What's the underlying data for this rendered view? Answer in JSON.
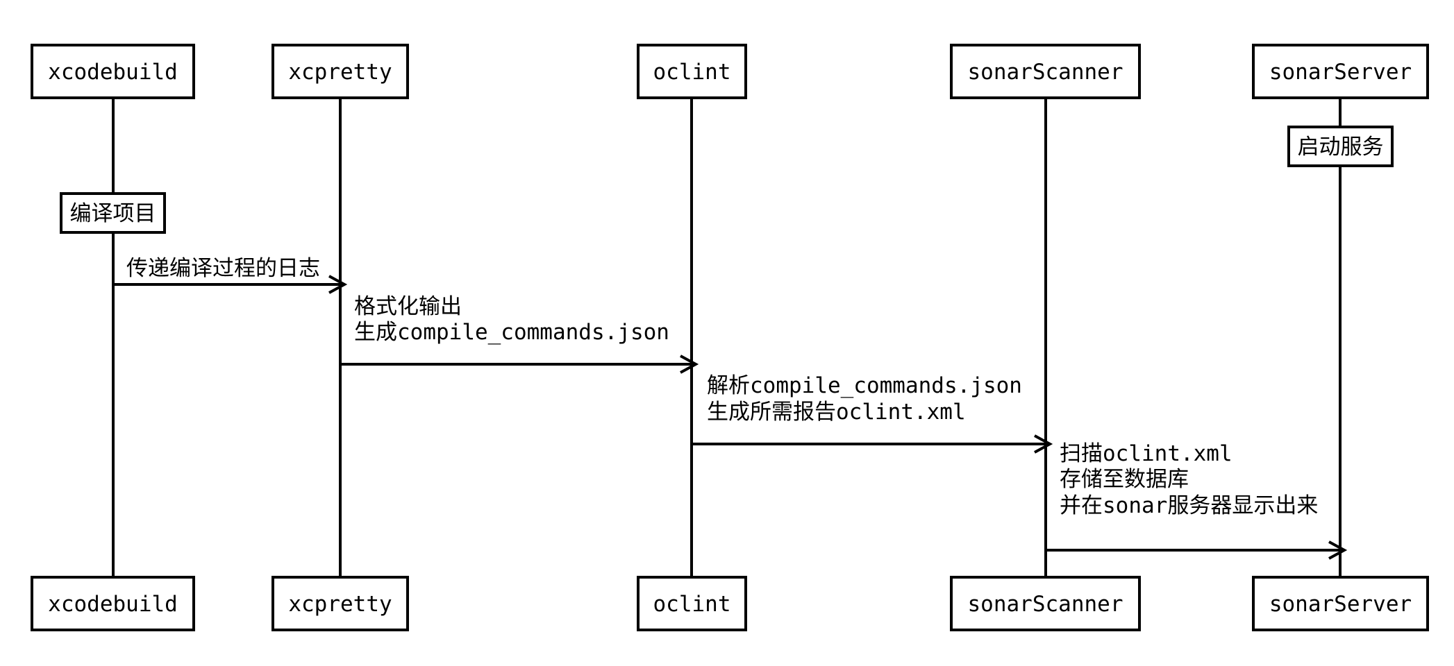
{
  "participants": [
    {
      "id": "xcodebuild",
      "label": "xcodebuild"
    },
    {
      "id": "xcpretty",
      "label": "xcpretty"
    },
    {
      "id": "oclint",
      "label": "oclint"
    },
    {
      "id": "sonarScanner",
      "label": "sonarScanner"
    },
    {
      "id": "sonarServer",
      "label": "sonarServer"
    }
  ],
  "activations": [
    {
      "participant": "xcodebuild",
      "label": "编译项目"
    },
    {
      "participant": "sonarServer",
      "label": "启动服务"
    }
  ],
  "messages": [
    {
      "from": "xcodebuild",
      "to": "xcpretty",
      "lines": [
        "传递编译过程的日志"
      ]
    },
    {
      "from": "xcpretty",
      "to": "oclint",
      "lines": [
        "格式化输出",
        "生成compile_commands.json"
      ]
    },
    {
      "from": "oclint",
      "to": "sonarScanner",
      "lines": [
        "解析compile_commands.json",
        "生成所需报告oclint.xml"
      ]
    },
    {
      "from": "sonarScanner",
      "to": "sonarServer",
      "lines": [
        "扫描oclint.xml",
        "存储至数据库",
        "并在sonar服务器显示出来"
      ]
    }
  ],
  "colors": {
    "stroke": "#000000",
    "background": "#ffffff"
  }
}
